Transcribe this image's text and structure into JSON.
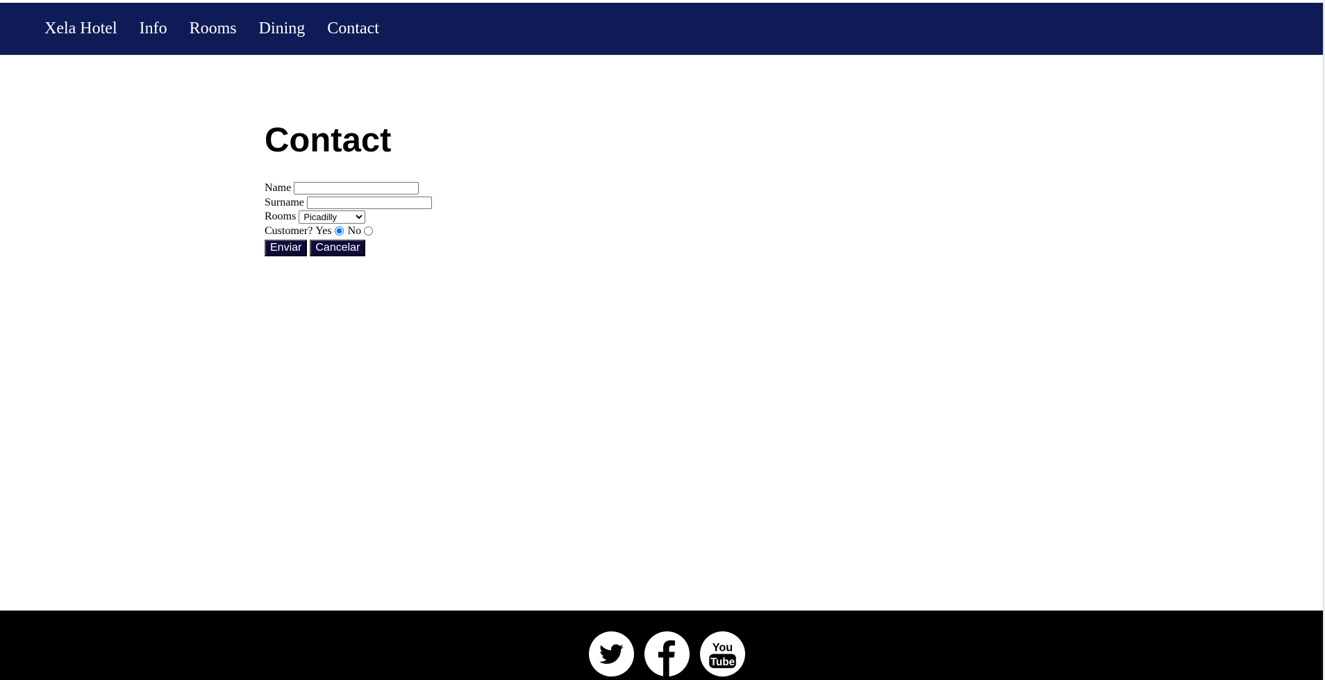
{
  "nav": {
    "items": [
      {
        "label": "Xela Hotel"
      },
      {
        "label": "Info"
      },
      {
        "label": "Rooms"
      },
      {
        "label": "Dining"
      },
      {
        "label": "Contact"
      }
    ]
  },
  "page_title": "Contact",
  "form": {
    "name_label": "Name",
    "name_value": "",
    "surname_label": "Surname",
    "surname_value": "",
    "rooms_label": "Rooms",
    "rooms_selected": "Picadilly",
    "customer_label": "Customer?",
    "yes_label": "Yes",
    "no_label": "No",
    "customer_selected": "Yes",
    "submit_label": "Enviar",
    "cancel_label": "Cancelar"
  },
  "footer": {
    "social": [
      "twitter-icon",
      "facebook-icon",
      "youtube-icon"
    ],
    "youtube_text_top": "You",
    "youtube_text_bottom": "Tube"
  },
  "colors": {
    "nav_bg": "#0e1b56",
    "button_bg": "#0f0a3d",
    "footer_bg": "#000000"
  }
}
